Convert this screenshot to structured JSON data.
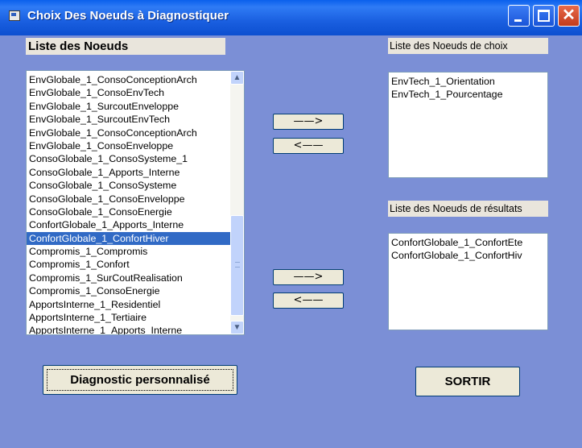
{
  "window": {
    "title": "Choix Des Noeuds à Diagnostiquer",
    "controls": {
      "minimize": "",
      "maximize": "",
      "close": "✕"
    }
  },
  "labels": {
    "noeuds": "Liste des Noeuds",
    "choix": "Liste des Noeuds de choix",
    "resultats": "Liste des Noeuds de résultats"
  },
  "lists": {
    "noeuds": [
      "EnvGlobale_1_ConsoConceptionArch",
      "EnvGlobale_1_ConsoEnvTech",
      "EnvGlobale_1_SurcoutEnveloppe",
      "EnvGlobale_1_SurcoutEnvTech",
      "EnvGlobale_1_ConsoConceptionArch",
      "EnvGlobale_1_ConsoEnveloppe",
      "ConsoGlobale_1_ConsoSysteme_1",
      "ConsoGlobale_1_Apports_Interne",
      "ConsoGlobale_1_ConsoSysteme",
      "ConsoGlobale_1_ConsoEnveloppe",
      "ConsoGlobale_1_ConsoEnergie",
      "ConfortGlobale_1_Apports_Interne",
      "ConfortGlobale_1_ConfortHiver",
      "Compromis_1_Compromis",
      "Compromis_1_Confort",
      "Compromis_1_SurCoutRealisation",
      "Compromis_1_ConsoEnergie",
      "ApportsInterne_1_Residentiel",
      "ApportsInterne_1_Tertiaire",
      "ApportsInterne_1_Apports_Interne"
    ],
    "noeuds_selected_index": 12,
    "choix": [
      "EnvTech_1_Orientation",
      "EnvTech_1_Pourcentage"
    ],
    "resultats": [
      "ConfortGlobale_1_ConfortEte",
      "ConfortGlobale_1_ConfortHiv"
    ]
  },
  "scrollbar": {
    "up": "▲",
    "down": "▼"
  },
  "buttons": {
    "add_choix": "——>",
    "remove_choix": "<——",
    "add_resultat": "——>",
    "remove_resultat": "<——",
    "diagnostic": "Diagnostic personnalisé",
    "sortir": "SORTIR"
  },
  "colors": {
    "background": "#7b8fd6",
    "titlebar": "#0a60ec",
    "selection": "#316ac5"
  }
}
